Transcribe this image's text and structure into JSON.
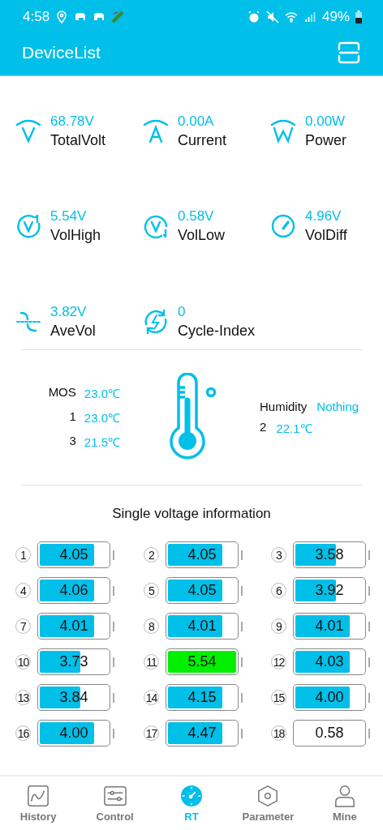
{
  "status_bar": {
    "time": "4:58",
    "battery": "49%"
  },
  "app_bar": {
    "title": "DeviceList"
  },
  "metrics": [
    {
      "kind": "volt",
      "value": "68.78V",
      "label": "TotalVolt"
    },
    {
      "kind": "amp",
      "value": "0.00A",
      "label": "Current"
    },
    {
      "kind": "watt",
      "value": "0.00W",
      "label": "Power"
    },
    {
      "kind": "high",
      "value": "5.54V",
      "label": "VolHigh"
    },
    {
      "kind": "low",
      "value": "0.58V",
      "label": "VolLow"
    },
    {
      "kind": "diff",
      "value": "4.96V",
      "label": "VolDiff"
    },
    {
      "kind": "ave",
      "value": "3.82V",
      "label": "AveVol"
    },
    {
      "kind": "cycle",
      "value": "0",
      "label": "Cycle-Index"
    }
  ],
  "temperatures": {
    "left": [
      {
        "label": "MOS",
        "value": "23.0℃"
      },
      {
        "label": "1",
        "value": "23.0℃"
      },
      {
        "label": "3",
        "value": "21.5℃"
      }
    ],
    "humidity": {
      "label": "Humidity",
      "value": "Nothing"
    },
    "right": [
      {
        "label": "2",
        "value": "22.1℃"
      }
    ]
  },
  "cells": {
    "title": "Single voltage information",
    "items": [
      {
        "index": "1",
        "voltage": "4.05",
        "level": 0.8,
        "color": "#00bfe8"
      },
      {
        "index": "2",
        "voltage": "4.05",
        "level": 0.8,
        "color": "#00bfe8"
      },
      {
        "index": "3",
        "voltage": "3.58",
        "level": 0.6,
        "color": "#00bfe8"
      },
      {
        "index": "4",
        "voltage": "4.06",
        "level": 0.8,
        "color": "#00bfe8"
      },
      {
        "index": "5",
        "voltage": "4.05",
        "level": 0.8,
        "color": "#00bfe8"
      },
      {
        "index": "6",
        "voltage": "3.92",
        "level": 0.6,
        "color": "#00bfe8"
      },
      {
        "index": "7",
        "voltage": "4.01",
        "level": 0.8,
        "color": "#00bfe8"
      },
      {
        "index": "8",
        "voltage": "4.01",
        "level": 0.8,
        "color": "#00bfe8"
      },
      {
        "index": "9",
        "voltage": "4.01",
        "level": 0.8,
        "color": "#00bfe8"
      },
      {
        "index": "10",
        "voltage": "3.73",
        "level": 0.6,
        "color": "#00bfe8"
      },
      {
        "index": "11",
        "voltage": "5.54",
        "level": 1,
        "color": "#00f000"
      },
      {
        "index": "12",
        "voltage": "4.03",
        "level": 0.8,
        "color": "#00bfe8"
      },
      {
        "index": "13",
        "voltage": "3.84",
        "level": 0.6,
        "color": "#00bfe8"
      },
      {
        "index": "14",
        "voltage": "4.15",
        "level": 0.8,
        "color": "#00bfe8"
      },
      {
        "index": "15",
        "voltage": "4.00",
        "level": 0.8,
        "color": "#00bfe8"
      },
      {
        "index": "16",
        "voltage": "4.00",
        "level": 0.8,
        "color": "#00bfe8"
      },
      {
        "index": "17",
        "voltage": "4.47",
        "level": 0.8,
        "color": "#00bfe8"
      },
      {
        "index": "18",
        "voltage": "0.58"
      }
    ]
  },
  "nav": [
    {
      "kind": "history",
      "label": "History",
      "selected": false
    },
    {
      "kind": "control",
      "label": "Control",
      "selected": false
    },
    {
      "kind": "rt",
      "label": "RT",
      "selected": true
    },
    {
      "kind": "parameter",
      "label": "Parameter",
      "selected": false
    },
    {
      "kind": "mine",
      "label": "Mine",
      "selected": false
    }
  ]
}
